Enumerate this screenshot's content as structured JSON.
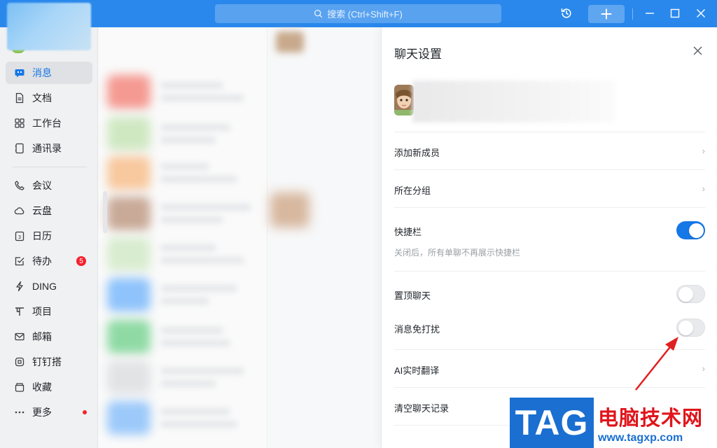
{
  "titlebar": {
    "search_placeholder": "搜索 (Ctrl+Shift+F)",
    "icons": [
      "history-icon",
      "plus-icon",
      "minimize-icon",
      "maximize-icon",
      "close-icon"
    ],
    "accent": "#2a88ec"
  },
  "sidebar": {
    "items": [
      {
        "label": "消息",
        "icon": "chat-icon",
        "active": true
      },
      {
        "label": "文档",
        "icon": "document-icon"
      },
      {
        "label": "工作台",
        "icon": "grid-icon"
      },
      {
        "label": "通讯录",
        "icon": "contacts-icon"
      },
      {
        "label": "会议",
        "icon": "phone-icon"
      },
      {
        "label": "云盘",
        "icon": "cloud-icon"
      },
      {
        "label": "日历",
        "icon": "calendar-icon"
      },
      {
        "label": "待办",
        "icon": "todo-icon",
        "badge": "5"
      },
      {
        "label": "DING",
        "icon": "lightning-icon"
      },
      {
        "label": "项目",
        "icon": "project-icon"
      },
      {
        "label": "邮箱",
        "icon": "mail-icon"
      },
      {
        "label": "钉钉搭",
        "icon": "app-builder-icon"
      },
      {
        "label": "收藏",
        "icon": "favorites-icon"
      },
      {
        "label": "更多",
        "icon": "more-icon",
        "dot": true
      }
    ],
    "active_color": "#1677e6"
  },
  "panel": {
    "title": "聊天设置",
    "rows": {
      "add_member": "添加新成员",
      "group": "所在分组",
      "shortcut_bar": "快捷栏",
      "shortcut_hint": "关闭后，所有单聊不再展示快捷栏",
      "pin_chat": "置顶聊天",
      "mute": "消息免打扰",
      "ai_translate": "AI实时翻译",
      "clear_history": "清空聊天记录"
    },
    "toggles": {
      "shortcut_bar": true,
      "pin_chat": false,
      "mute": false
    },
    "toggle_on_color": "#1677e6"
  },
  "watermark": {
    "tag": "TAG",
    "title": "电脑技术网",
    "url": "www.tagxp.com"
  }
}
